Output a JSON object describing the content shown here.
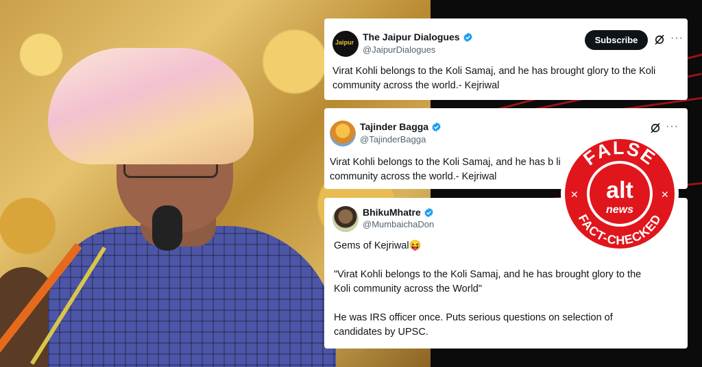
{
  "tweets": [
    {
      "name": "The Jaipur Dialogues",
      "handle": "@JaipurDialogues",
      "avatar_text": "Jaipur",
      "subscribe_label": "Subscribe",
      "more_label": "···",
      "text": "Virat Kohli belongs to the Koli Samaj, and he has brought glory to the Koli community across the world.- Kejriwal"
    },
    {
      "name": "Tajinder Bagga",
      "handle": "@TajinderBagga",
      "more_label": "···",
      "text": "Virat Kohli belongs to the Koli Samaj, and he has b                          li\ncommunity across the world.- Kejriwal"
    },
    {
      "name": "BhikuMhatre",
      "handle": "@MumbaichaDon",
      "text": "Gems of Kejriwal😝\n\n\"Virat Kohli belongs to the Koli Samaj, and he has brought glory to the\nKoli community across the World\"\n\nHe was IRS officer once. Puts serious questions on selection of\ncandidates by UPSC."
    }
  ],
  "badge": {
    "top_text": "FALSE",
    "logo_alt": "alt",
    "logo_news": "news",
    "bottom_text": "FACT-CHECKED",
    "color": "#e0161c"
  },
  "colors": {
    "verified": "#1d9bf0",
    "streak": "#b3141a"
  }
}
